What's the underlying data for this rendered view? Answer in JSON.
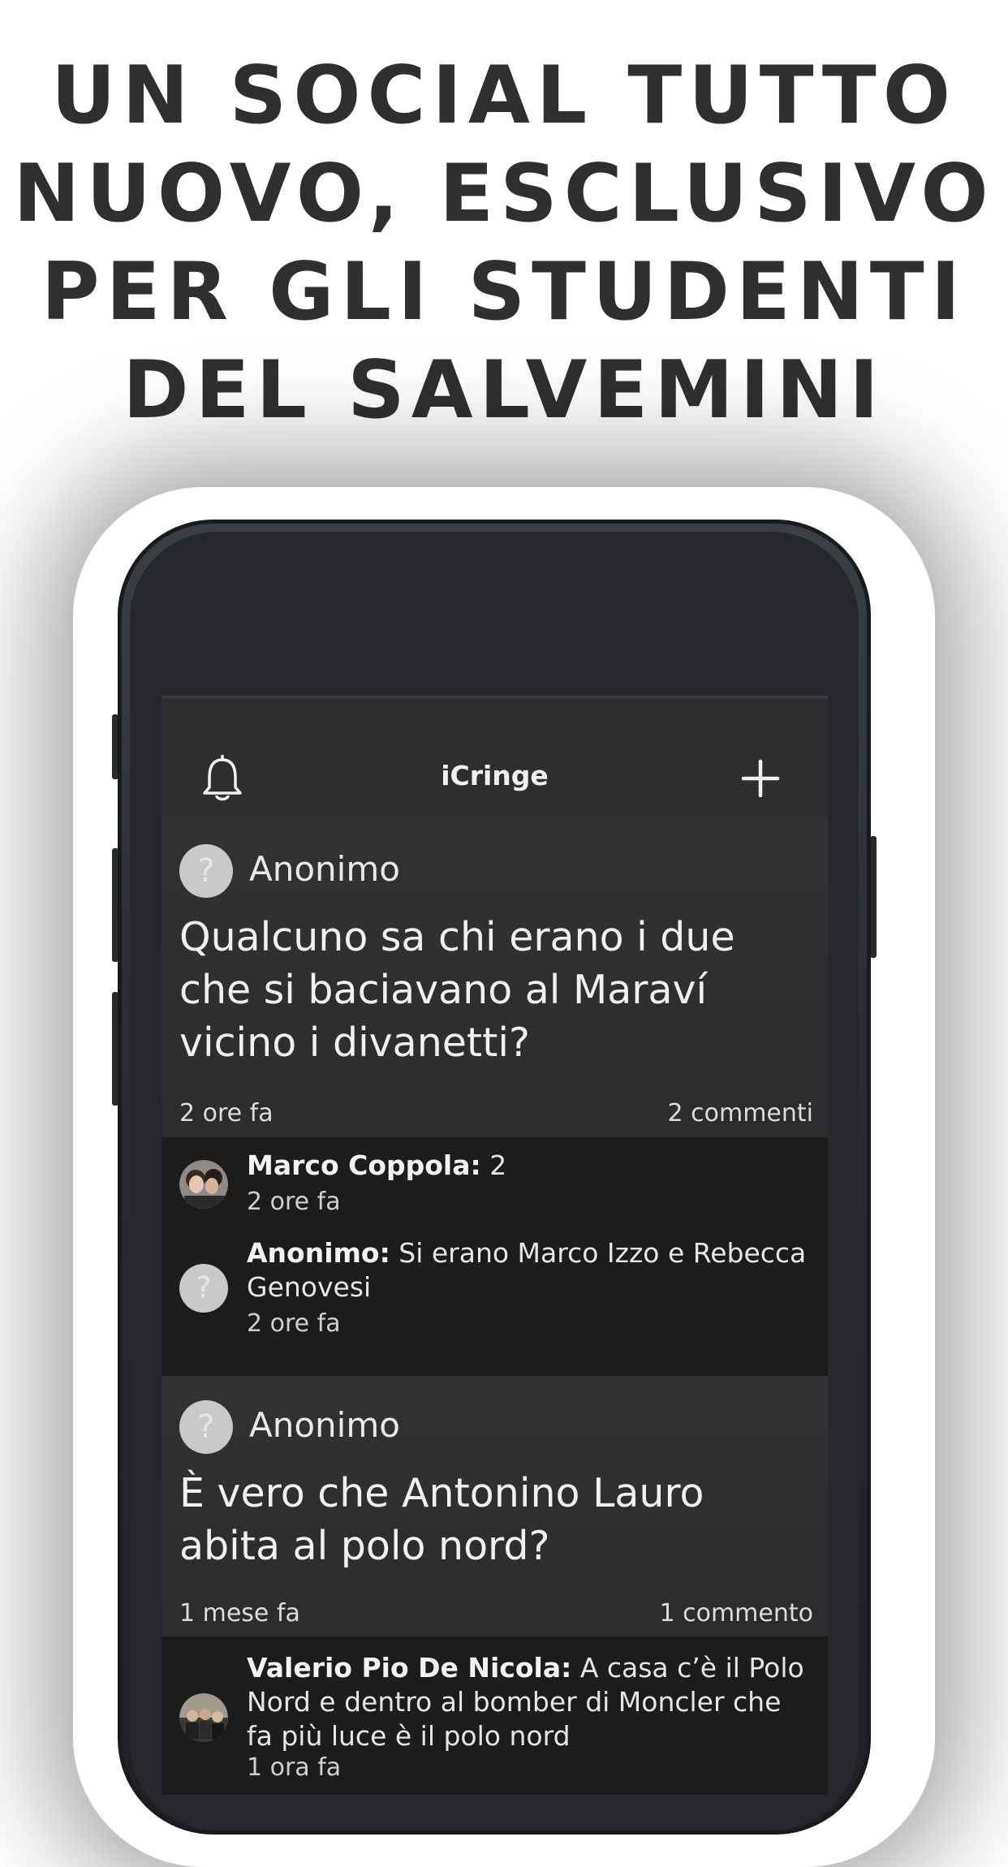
{
  "headline": {
    "lines": [
      "UN SOCIAL TUTTO",
      "NUOVO, ESCLUSIVO",
      "PER GLI STUDENTI",
      "DEL SALVEMINI"
    ]
  },
  "app": {
    "title": "iCringe",
    "icons": {
      "left": "bell-icon",
      "right": "plus-icon"
    }
  },
  "posts": [
    {
      "author": "Anonimo",
      "avatar_glyph": "?",
      "text": "Qualcuno sa chi erano i due che si baciavano al Maraví vicino i divanetti?",
      "time": "2 ore fa",
      "comment_count": "2 commenti",
      "comments": [
        {
          "author": "Marco Coppola:",
          "text": "2",
          "time": "2 ore fa",
          "avatar": "photo"
        },
        {
          "author": "Anonimo:",
          "text": "Si erano Marco Izzo e Rebecca Genovesi",
          "time": "2 ore fa",
          "avatar": "?"
        }
      ]
    },
    {
      "author": "Anonimo",
      "avatar_glyph": "?",
      "text": "È vero che Antonino Lauro abita al polo nord?",
      "time": "1 mese fa",
      "comment_count": "1 commento",
      "comments": [
        {
          "author": "Valerio Pio De Nicola:",
          "text": "A casa c’è il Polo Nord e dentro al bomber di Moncler che fa più luce è il polo nord",
          "time": "1 ora fa",
          "avatar": "photo"
        }
      ]
    }
  ],
  "colors": {
    "background": "#ffffff",
    "headline": "#2f2f2f",
    "screen": "#141414",
    "card": "#2e2e30"
  }
}
